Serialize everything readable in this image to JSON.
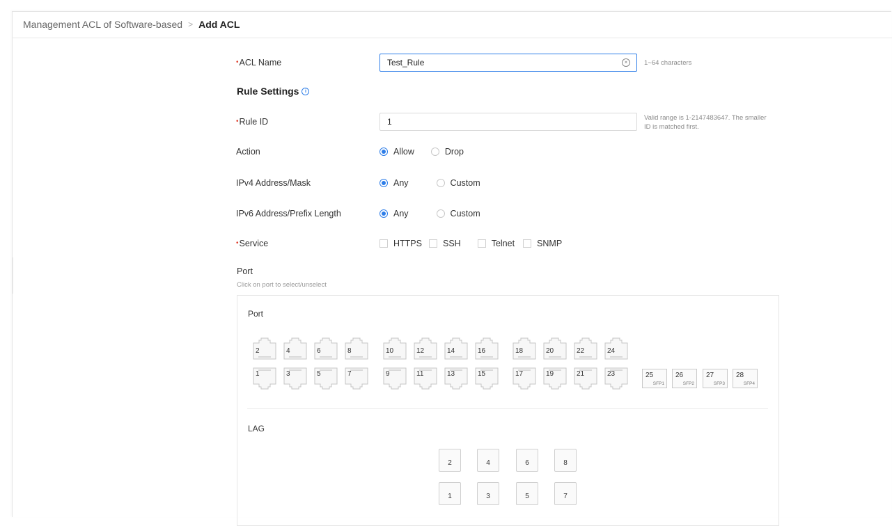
{
  "breadcrumb": {
    "parent": "Management ACL of Software-based",
    "separator": ">",
    "current": "Add ACL"
  },
  "form": {
    "acl_name": {
      "label": "ACL Name",
      "value": "Test_Rule",
      "hint": "1~64 characters"
    },
    "rule_settings_title": "Rule Settings",
    "rule_id": {
      "label": "Rule ID",
      "value": "1",
      "hint_line1": "Valid range is 1-2147483647. The smaller",
      "hint_line2": "ID is matched first."
    },
    "action": {
      "label": "Action",
      "options": [
        "Allow",
        "Drop"
      ],
      "selected": "Allow"
    },
    "ipv4": {
      "label": "IPv4 Address/Mask",
      "options": [
        "Any",
        "Custom"
      ],
      "selected": "Any"
    },
    "ipv6": {
      "label": "IPv6 Address/Prefix Length",
      "options": [
        "Any",
        "Custom"
      ],
      "selected": "Any"
    },
    "service": {
      "label": "Service",
      "options": [
        "HTTPS",
        "SSH",
        "Telnet",
        "SNMP"
      ]
    }
  },
  "port_section": {
    "title": "Port",
    "subtitle": "Click on port to select/unselect",
    "panel_port_label": "Port",
    "top_ports": [
      "2",
      "4",
      "6",
      "8",
      "10",
      "12",
      "14",
      "16",
      "18",
      "20",
      "22",
      "24"
    ],
    "bottom_ports": [
      "1",
      "3",
      "5",
      "7",
      "9",
      "11",
      "13",
      "15",
      "17",
      "19",
      "21",
      "23"
    ],
    "sfp_ports": [
      {
        "num": "25",
        "label": "SFP1"
      },
      {
        "num": "26",
        "label": "SFP2"
      },
      {
        "num": "27",
        "label": "SFP3"
      },
      {
        "num": "28",
        "label": "SFP4"
      }
    ],
    "lag_label": "LAG",
    "lag_top": [
      "2",
      "4",
      "6",
      "8"
    ],
    "lag_bottom": [
      "1",
      "3",
      "5",
      "7"
    ]
  },
  "icons": {
    "info": "info-icon",
    "clear": "clear-input-icon"
  },
  "colors": {
    "accent": "#2d7de8",
    "required": "#e0412f"
  }
}
